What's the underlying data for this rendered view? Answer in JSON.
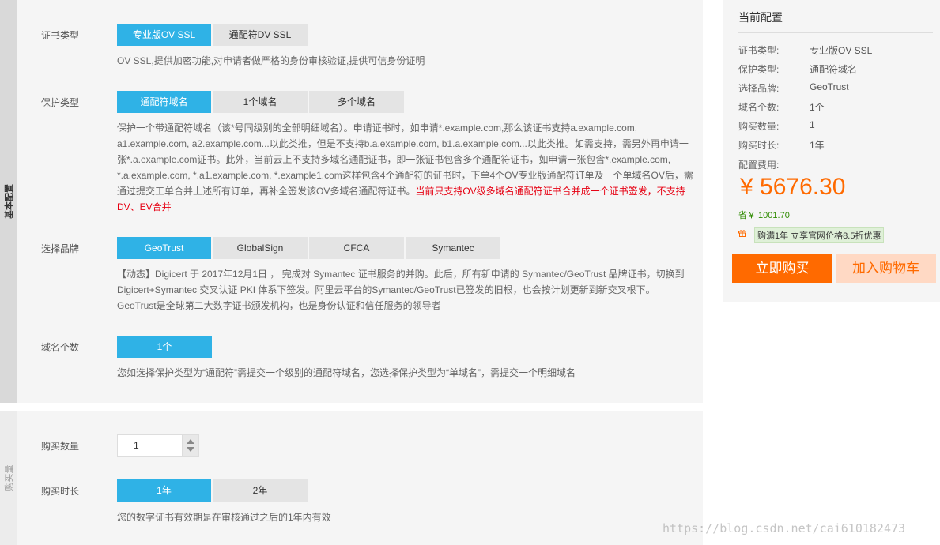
{
  "sections": {
    "basic": "基本配置",
    "purchase": "购买量"
  },
  "cert_type": {
    "label": "证书类型",
    "options": [
      "专业版OV SSL",
      "通配符DV SSL"
    ],
    "selected": 0,
    "desc": "OV SSL,提供加密功能,对申请者做严格的身份审核验证,提供可信身份证明"
  },
  "protect_type": {
    "label": "保护类型",
    "options": [
      "通配符域名",
      "1个域名",
      "多个域名"
    ],
    "selected": 0,
    "desc_l1": "保护一个带通配符域名（该*号同级别的全部明细域名）。申请证书时，如申请*.example.com,那么该证书支持a.example.com,",
    "desc_l2": "a1.example.com, a2.example.com...以此类推，但是不支持b.a.example.com, b1.a.example.com...以此类推。如需支持，需另外再申请一",
    "desc_l3": "张*.a.example.com证书。此外，当前云上不支持多域名通配证书，即一张证书包含多个通配符证书，如申请一张包含*.example.com,",
    "desc_l4": "*.a.example.com, *.a1.example.com, *.example1.com这样包含4个通配符的证书时，下单4个OV专业版通配符订单及一个单域名OV后，需",
    "desc_l5": "通过提交工单合并上述所有订单，再补全签发该OV多域名通配符证书。",
    "desc_warn_a": "当前只支持OV级多域名通配符证书合并成一个证书签发，不支持",
    "desc_warn_b": "DV、EV合并"
  },
  "brand": {
    "label": "选择品牌",
    "options": [
      "GeoTrust",
      "GlobalSign",
      "CFCA",
      "Symantec"
    ],
    "selected": 0,
    "desc_l1": "【动态】Digicert 于 2017年12月1日 ， 完成对 Symantec 证书服务的并购。此后，所有新申请的 Symantec/GeoTrust 品牌证书，切换到",
    "desc_l2": "Digicert+Symantec 交叉认证 PKI 体系下签发。阿里云平台的Symantec/GeoTrust已签发的旧根，也会按计划更新到新交叉根下。",
    "desc_l3": "GeoTrust是全球第二大数字证书颁发机构，也是身份认证和信任服务的领导者"
  },
  "domain_count": {
    "label": "域名个数",
    "options": [
      "1个"
    ],
    "selected": 0,
    "desc": "您如选择保护类型为“通配符”需提交一个级别的通配符域名，您选择保护类型为“单域名”，需提交一个明细域名"
  },
  "quantity": {
    "label": "购买数量",
    "value": "1"
  },
  "duration": {
    "label": "购买时长",
    "options": [
      "1年",
      "2年"
    ],
    "selected": 0,
    "desc": "您的数字证书有效期是在审核通过之后的1年内有效"
  },
  "summary": {
    "title": "当前配置",
    "rows": [
      {
        "k": "证书类型:",
        "v": "专业版OV SSL"
      },
      {
        "k": "保护类型:",
        "v": "通配符域名"
      },
      {
        "k": "选择品牌:",
        "v": "GeoTrust"
      },
      {
        "k": "域名个数:",
        "v": "1个"
      },
      {
        "k": "购买数量:",
        "v": "1"
      },
      {
        "k": "购买时长:",
        "v": "1年"
      }
    ],
    "fee_label": "配置费用:",
    "price": "¥ 5676.30",
    "saving": "省￥ 1001.70",
    "promo": "购满1年 立享官网价格8.5折优惠",
    "buy_label": "立即购买",
    "cart_label": "加入购物车"
  },
  "watermark": "https://blog.csdn.net/cai610182473",
  "colors": {
    "accent": "#2fb2e6",
    "price": "#ff6a00",
    "warning": "#e60012",
    "saving": "#2e8b00"
  }
}
